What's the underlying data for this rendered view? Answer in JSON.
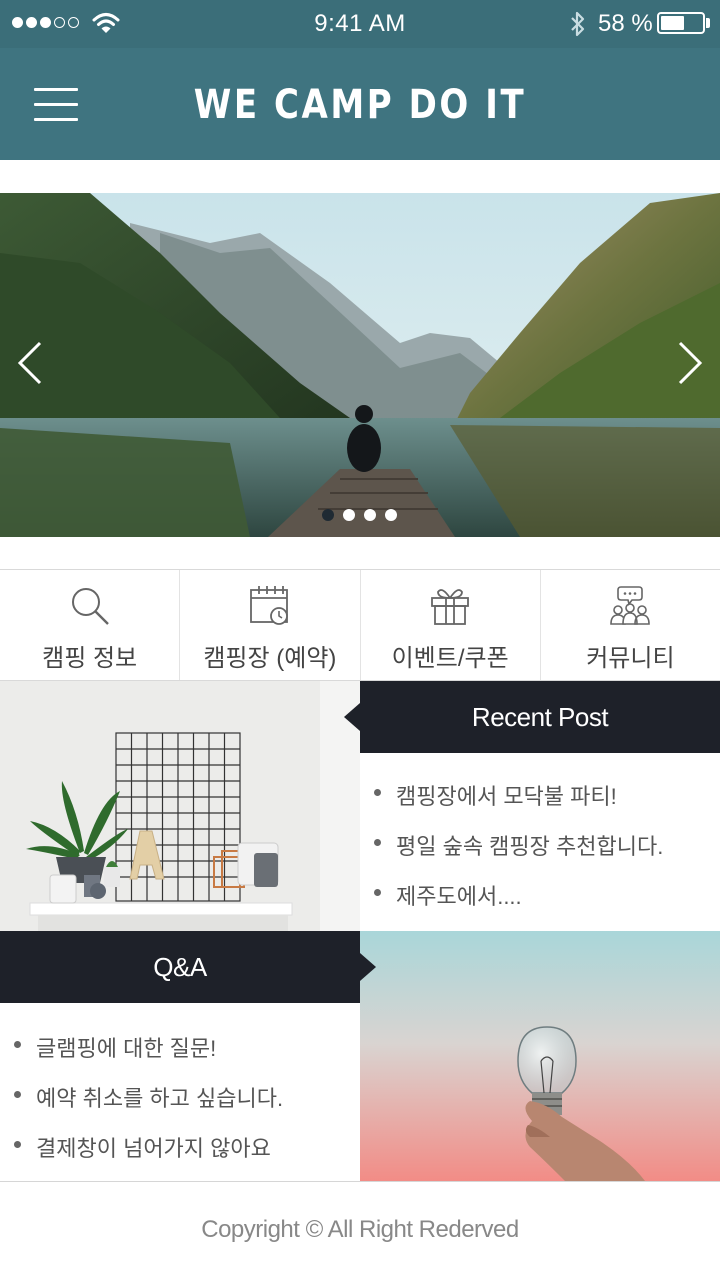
{
  "status_bar": {
    "time": "9:41 AM",
    "battery_text": "58 %",
    "battery_level": 0.58,
    "signal_bars_filled": 3,
    "signal_bars_total": 5,
    "icons": [
      "signal-dots-icon",
      "wifi-icon",
      "bluetooth-icon",
      "battery-icon"
    ]
  },
  "header": {
    "title": "WE CAMP DO IT",
    "menu_icon": "hamburger-icon",
    "color": "#3f7480"
  },
  "slider": {
    "slide_count": 4,
    "active_index": 0,
    "prev_icon": "chevron-left-icon",
    "next_icon": "chevron-right-icon"
  },
  "categories": [
    {
      "label": "캠핑 정보",
      "icon": "search-icon"
    },
    {
      "label": "캠핑장 (예약)",
      "icon": "calendar-clock-icon"
    },
    {
      "label": "이벤트/쿠폰",
      "icon": "gift-icon"
    },
    {
      "label": "커뮤니티",
      "icon": "community-icon"
    }
  ],
  "recent_post": {
    "title": "Recent Post",
    "items": [
      "캠핑장에서 모닥불 파티!",
      "평일 숲속 캠핑장 추천합니다.",
      "제주도에서...."
    ]
  },
  "qa": {
    "title": "Q&A",
    "items": [
      "글램핑에 대한 질문!",
      "예약 취소를 하고 싶습니다.",
      "결제창이 넘어가지 않아요"
    ]
  },
  "footer": {
    "copyright": "Copyright © All Right Rederved"
  },
  "colors": {
    "header": "#3f7480",
    "status_bar": "#3b6e79",
    "dark_bar": "#1e2129"
  }
}
